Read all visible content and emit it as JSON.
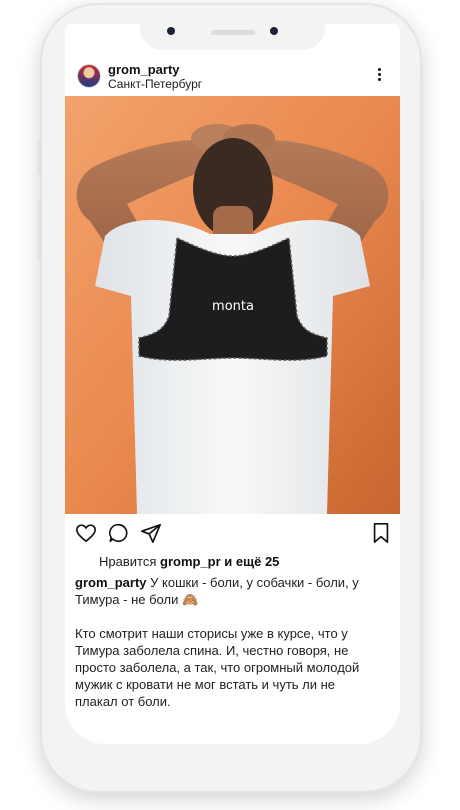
{
  "post": {
    "username": "grom_party",
    "location": "Санкт-Петербург",
    "photo_text": "monta",
    "likes_prefix": "Нравится",
    "likes_user": "gromp_pr",
    "likes_suffix": "и ещё 25",
    "caption_user": "grom_party",
    "caption_line1": "У кошки - боли, у собачки - боли, у Тимура - не боли 🙈",
    "caption_paragraph2": "Кто смотрит наши сторисы уже в курсе, что у Тимура заболела спина. И, честно говоря, не просто заболела, а так, что огромный молодой мужик с кровати не мог встать и чуть ли не плакал от боли."
  },
  "icons": {
    "more": "more-vertical-icon",
    "like": "heart-icon",
    "comment": "comment-icon",
    "share": "send-icon",
    "save": "bookmark-icon"
  },
  "colors": {
    "wall": "#e98d52",
    "shirt": "#f4f5f6",
    "brace": "#1d1d1f",
    "phone_frame": "#f3f3f3"
  }
}
